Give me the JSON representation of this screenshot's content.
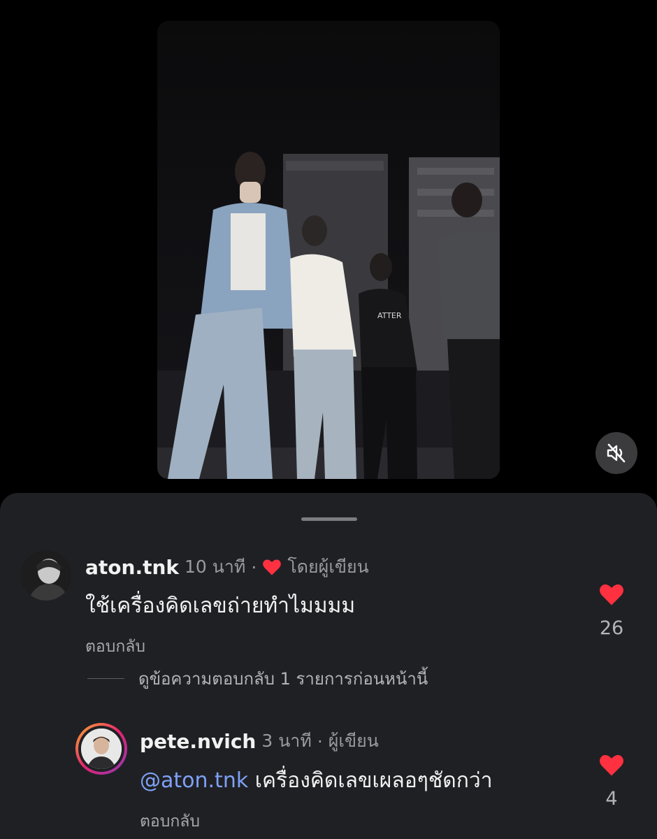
{
  "video": {
    "mute_icon": "speaker-muted-icon",
    "shirt_text_back": "ATTER"
  },
  "comments": [
    {
      "username": "aton.tnk",
      "time": "10 นาที",
      "separator": "·",
      "liked_by_author_icon": "heart-icon",
      "liked_by_author_label": "โดยผู้เขียน",
      "text": "ใช้เครื่องคิดเลขถ่ายทำไมมมม",
      "reply_label": "ตอบกลับ",
      "like_count": "26"
    }
  ],
  "view_previous_replies": "ดูข้อความตอบกลับ 1 รายการก่อนหน้านี้",
  "reply": {
    "username": "pete.nvich",
    "time": "3 นาที",
    "separator": "·",
    "author_label": "ผู้เขียน",
    "mention": "@aton.tnk",
    "text": " เครื่องคิดเลขเผลอๆชัดกว่า",
    "reply_label": "ตอบกลับ",
    "like_count": "4"
  },
  "colors": {
    "like_red": "#ff3040",
    "mention_blue": "#7ea1f5",
    "sheet_bg": "#1f2024"
  }
}
